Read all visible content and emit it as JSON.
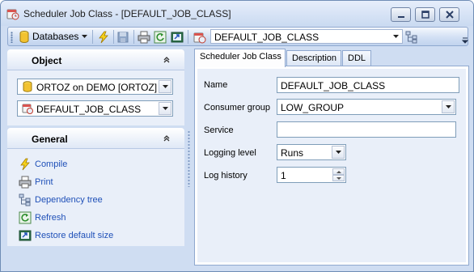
{
  "window": {
    "title": "Scheduler Job Class - [DEFAULT_JOB_CLASS]"
  },
  "toolbar": {
    "databases_label": "Databases",
    "object_combo_value": "DEFAULT_JOB_CLASS",
    "icons": [
      "database-icon",
      "lightning-icon",
      "save-icon",
      "print-icon",
      "refresh-icon",
      "restore-size-icon",
      "job-class-icon",
      "tree-icon"
    ]
  },
  "left_panel": {
    "object_section": {
      "title": "Object",
      "database_combo": "ORTOZ on DEMO [ORTOZ]",
      "object_combo": "DEFAULT_JOB_CLASS"
    },
    "general_section": {
      "title": "General",
      "items": [
        {
          "label": "Compile",
          "icon": "lightning-icon"
        },
        {
          "label": "Print",
          "icon": "print-icon"
        },
        {
          "label": "Dependency tree",
          "icon": "tree-icon"
        },
        {
          "label": "Refresh",
          "icon": "refresh-icon"
        },
        {
          "label": "Restore default size",
          "icon": "restore-size-icon"
        }
      ]
    }
  },
  "tabs": [
    {
      "label": "Scheduler Job Class",
      "active": true
    },
    {
      "label": "Description",
      "active": false
    },
    {
      "label": "DDL",
      "active": false
    }
  ],
  "form": {
    "name_label": "Name",
    "name_value": "DEFAULT_JOB_CLASS",
    "consumer_group_label": "Consumer group",
    "consumer_group_value": "LOW_GROUP",
    "service_label": "Service",
    "service_value": "",
    "logging_level_label": "Logging level",
    "logging_level_value": "Runs",
    "log_history_label": "Log history",
    "log_history_value": "1"
  },
  "colors": {
    "window_bg": "#cfddf2",
    "panel_bg": "#e9eff9",
    "link": "#1f50b8"
  }
}
